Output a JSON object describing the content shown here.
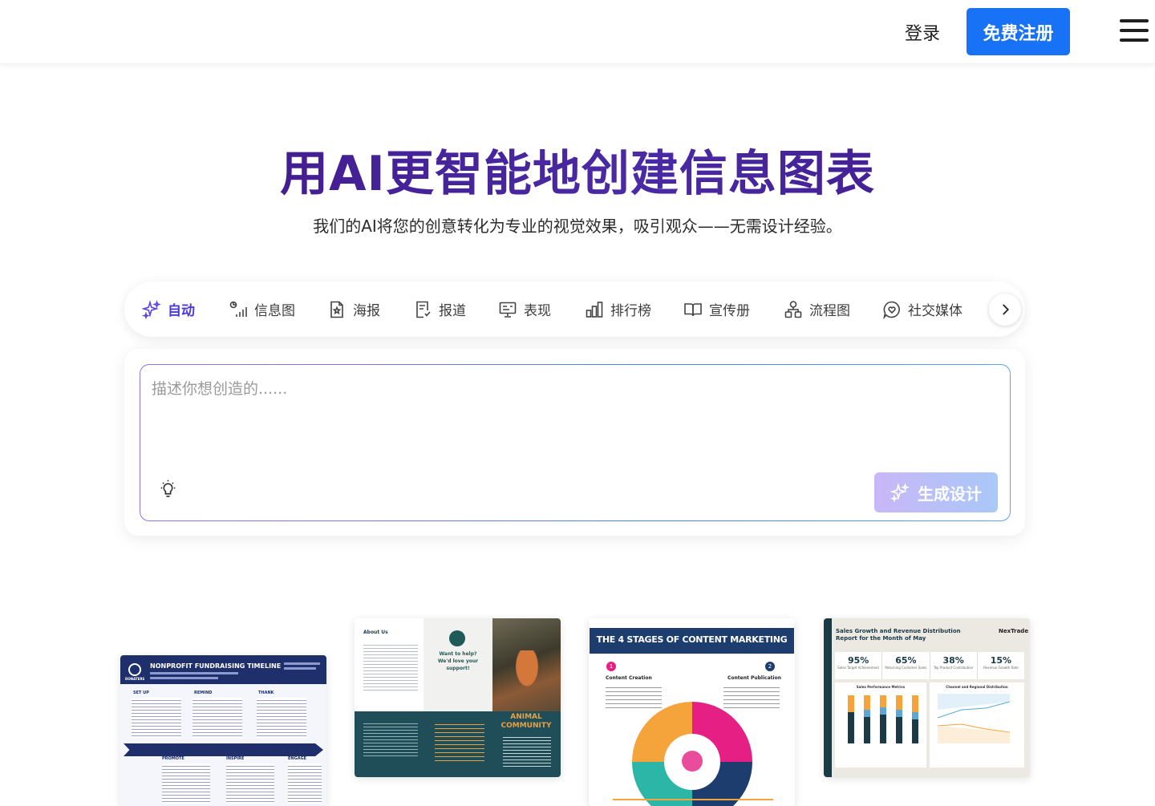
{
  "header": {
    "login_label": "登录",
    "signup_label": "免费注册"
  },
  "hero": {
    "title": "用AI更智能地创建信息图表",
    "subtitle": "我们的AI将您的创意转化为专业的视觉效果，吸引观众——无需设计经验。"
  },
  "tabs": [
    {
      "label": "自动",
      "icon": "sparkle-icon",
      "active": true
    },
    {
      "label": "信息图",
      "icon": "infographic-icon"
    },
    {
      "label": "海报",
      "icon": "poster-icon"
    },
    {
      "label": "报道",
      "icon": "report-icon"
    },
    {
      "label": "表现",
      "icon": "presentation-icon"
    },
    {
      "label": "排行榜",
      "icon": "ranking-icon"
    },
    {
      "label": "宣传册",
      "icon": "brochure-icon"
    },
    {
      "label": "流程图",
      "icon": "flowchart-icon"
    },
    {
      "label": "社交媒体",
      "icon": "social-media-icon"
    }
  ],
  "prompt": {
    "placeholder": "描述你想创造的......",
    "generate_label": "生成设计"
  },
  "templates": {
    "t1": {
      "title": "NONPROFIT FUNDRAISING TIMELINE",
      "brand": "DONATERS",
      "sections": [
        "SET UP",
        "REMIND",
        "THANK",
        "PROMOTE",
        "INSPIRE",
        "ENGAGE"
      ]
    },
    "t2": {
      "about": "About Us",
      "help": "Want to help? We'd love your support!",
      "brand": "ANIMAL COMMUNITY"
    },
    "t3": {
      "title": "THE 4 STAGES OF CONTENT MARKETING",
      "stage1": "Content Creation",
      "stage2": "Content Publication"
    },
    "t4": {
      "title": "Sales Growth and Revenue Distribution Report for the Month of May",
      "brand": "NexTrade",
      "kpis": [
        {
          "value": "95%",
          "label": "Sales Target Achievement"
        },
        {
          "value": "65%",
          "label": "Returning Customer Sales"
        },
        {
          "value": "38%",
          "label": "Top Product Contribution"
        },
        {
          "value": "15%",
          "label": "Revenue Growth Rate"
        }
      ],
      "chart1_title": "Sales Performance Metrics",
      "chart2_title": "Channel and Regional Distribution"
    }
  },
  "colors": {
    "brand_blue": "#1772f5",
    "title_purple": "#3a1a8c",
    "active_tab": "#4b3ad6"
  }
}
